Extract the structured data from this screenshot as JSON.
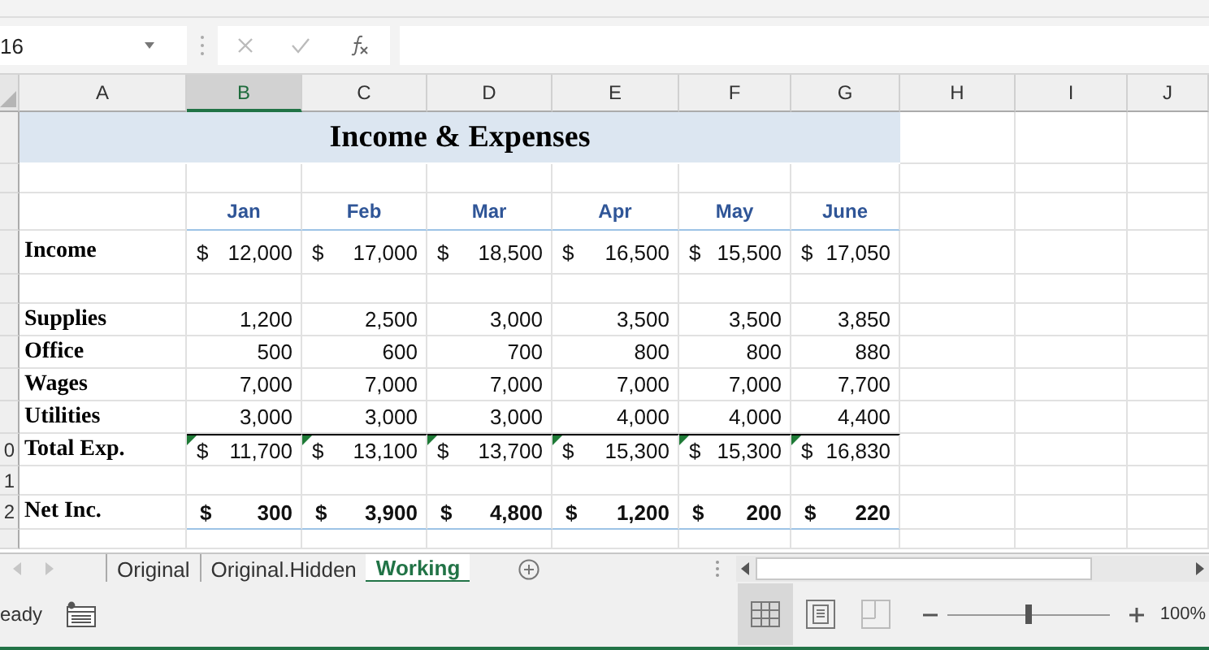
{
  "name_box": {
    "value": "16"
  },
  "columns": [
    {
      "label": "A",
      "selected": false
    },
    {
      "label": "B",
      "selected": true
    },
    {
      "label": "C",
      "selected": false
    },
    {
      "label": "D",
      "selected": false
    },
    {
      "label": "E",
      "selected": false
    },
    {
      "label": "F",
      "selected": false
    },
    {
      "label": "G",
      "selected": false
    },
    {
      "label": "H",
      "selected": false
    },
    {
      "label": "I",
      "selected": false
    },
    {
      "label": "J",
      "selected": false
    }
  ],
  "title": "Income & Expenses",
  "months": [
    "Jan",
    "Feb",
    "Mar",
    "Apr",
    "May",
    "June"
  ],
  "rows": [
    {
      "kind": "currency",
      "label": "Income",
      "cells": [
        {
          "currency": "$",
          "amount": "12,000"
        },
        {
          "currency": "$",
          "amount": "17,000"
        },
        {
          "currency": "$",
          "amount": "18,500"
        },
        {
          "currency": "$",
          "amount": "16,500"
        },
        {
          "currency": "$",
          "amount": "15,500"
        },
        {
          "currency": "$",
          "amount": "17,050"
        }
      ]
    },
    {
      "kind": "blank"
    },
    {
      "kind": "plain",
      "label": "Supplies",
      "cells": [
        {
          "amount": "1,200"
        },
        {
          "amount": "2,500"
        },
        {
          "amount": "3,000"
        },
        {
          "amount": "3,500"
        },
        {
          "amount": "3,500"
        },
        {
          "amount": "3,850"
        }
      ]
    },
    {
      "kind": "plain",
      "label": "Office",
      "cells": [
        {
          "amount": "500"
        },
        {
          "amount": "600"
        },
        {
          "amount": "700"
        },
        {
          "amount": "800"
        },
        {
          "amount": "800"
        },
        {
          "amount": "880"
        }
      ]
    },
    {
      "kind": "plain",
      "label": "Wages",
      "cells": [
        {
          "amount": "7,000"
        },
        {
          "amount": "7,000"
        },
        {
          "amount": "7,000"
        },
        {
          "amount": "7,000"
        },
        {
          "amount": "7,000"
        },
        {
          "amount": "7,700"
        }
      ]
    },
    {
      "kind": "plain",
      "label": "Utilities",
      "cells": [
        {
          "amount": "3,000"
        },
        {
          "amount": "3,000"
        },
        {
          "amount": "3,000"
        },
        {
          "amount": "4,000"
        },
        {
          "amount": "4,000"
        },
        {
          "amount": "4,400"
        }
      ]
    },
    {
      "kind": "total",
      "number": "0",
      "label": "Total Exp.",
      "flagged": true,
      "cells": [
        {
          "currency": "$",
          "amount": "11,700"
        },
        {
          "currency": "$",
          "amount": "13,100"
        },
        {
          "currency": "$",
          "amount": "13,700"
        },
        {
          "currency": "$",
          "amount": "15,300"
        },
        {
          "currency": "$",
          "amount": "15,300"
        },
        {
          "currency": "$",
          "amount": "16,830"
        }
      ]
    },
    {
      "kind": "blank",
      "number": "1"
    },
    {
      "kind": "net",
      "number": "2",
      "label": "Net Inc.",
      "cells": [
        {
          "currency": "$",
          "amount": "300"
        },
        {
          "currency": "$",
          "amount": "3,900"
        },
        {
          "currency": "$",
          "amount": "4,800"
        },
        {
          "currency": "$",
          "amount": "1,200"
        },
        {
          "currency": "$",
          "amount": "200"
        },
        {
          "currency": "$",
          "amount": "220"
        }
      ]
    },
    {
      "kind": "end"
    }
  ],
  "sheet_tabs": [
    {
      "label": "Original",
      "selected": false
    },
    {
      "label": "Original.Hidden",
      "selected": false
    },
    {
      "label": "Working",
      "selected": true
    }
  ],
  "status_bar": {
    "status": "eady",
    "views": [
      {
        "kind": "normal",
        "selected": true
      },
      {
        "kind": "page_layout",
        "selected": false
      },
      {
        "kind": "page_break",
        "selected": false
      }
    ],
    "zoom": {
      "level": 0.5,
      "reading": "100%"
    }
  }
}
